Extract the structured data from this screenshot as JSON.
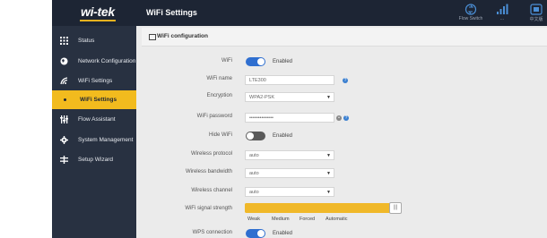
{
  "header": {
    "logo": "wi-tek",
    "title": "WiFi Settings",
    "icons": [
      {
        "name": "flow-switch-icon",
        "label": "Flow Switch"
      },
      {
        "name": "signal-icon",
        "label": "..."
      },
      {
        "name": "more-icon",
        "label": "中文版"
      }
    ]
  },
  "sidebar": {
    "items": [
      {
        "label": "Status",
        "icon": "grid-icon"
      },
      {
        "label": "Network Configuration",
        "icon": "globe-icon"
      },
      {
        "label": "WiFi Settings",
        "icon": "wifi-icon"
      },
      {
        "label": "WiFi Settings",
        "icon": "dot",
        "active": true
      },
      {
        "label": "Flow Assistant",
        "icon": "sliders-icon"
      },
      {
        "label": "System Management",
        "icon": "gear-icon"
      },
      {
        "label": "Setup Wizard",
        "icon": "wand-icon"
      }
    ]
  },
  "panel": {
    "title": "WiFi configuration",
    "wifi": {
      "label": "WiFi",
      "state": "Enabled",
      "on": true
    },
    "wifi_name": {
      "label": "WiFi name",
      "value": "LTE300"
    },
    "encryption": {
      "label": "Encryption",
      "value": "WPA2-PSK"
    },
    "wifi_password": {
      "label": "WiFi password",
      "value": "••••••••••••••"
    },
    "hide_wifi": {
      "label": "Hide WiFi",
      "state": "Enabled",
      "on": false
    },
    "wireless_protocol": {
      "label": "Wireless protocol",
      "value": "auto"
    },
    "wireless_bandwidth": {
      "label": "Wireless bandwidth",
      "value": "auto"
    },
    "wireless_channel": {
      "label": "Wireless channel",
      "value": "auto"
    },
    "signal_strength": {
      "label": "WiFi signal strength",
      "levels": [
        "Weak",
        "Medium",
        "Forced",
        "Automatic"
      ],
      "level": 1.0
    },
    "wps": {
      "label": "WPS connection",
      "state": "Enabled",
      "on": true
    }
  },
  "colors": {
    "topbar": "#1d2534",
    "sidebar": "#283141",
    "accent": "#f2bb1e",
    "toggle_on": "#2f6fd0",
    "help": "#3a7fd0"
  }
}
